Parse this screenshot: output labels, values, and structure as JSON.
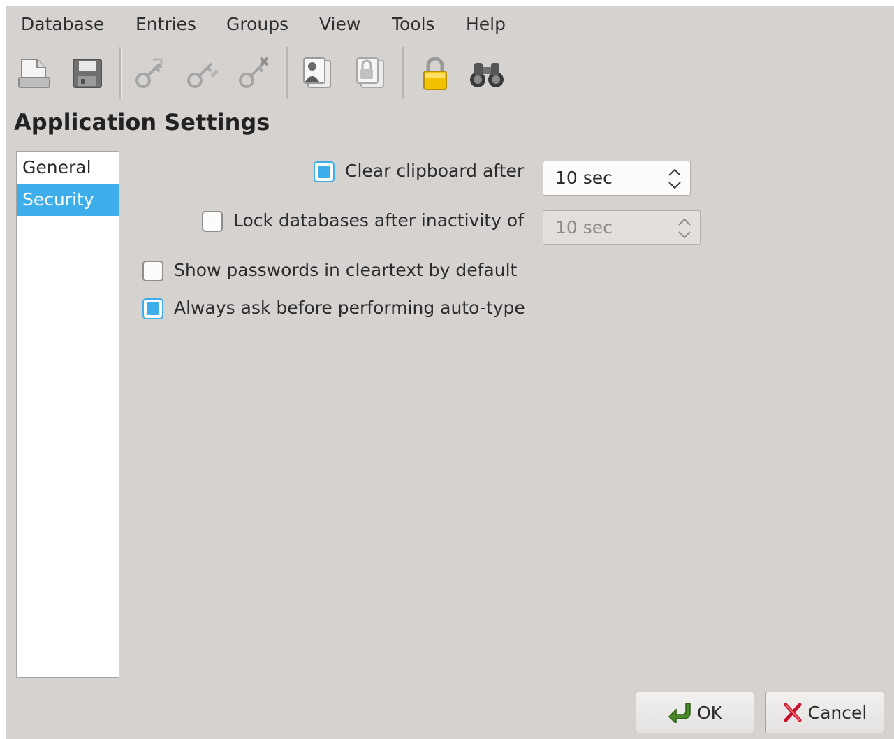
{
  "menubar": {
    "items": [
      "Database",
      "Entries",
      "Groups",
      "View",
      "Tools",
      "Help"
    ]
  },
  "toolbar": {
    "buttons": [
      {
        "icon": "new-database-icon"
      },
      {
        "icon": "save-database-icon"
      },
      {
        "icon": "add-entry-icon"
      },
      {
        "icon": "edit-entry-icon"
      },
      {
        "icon": "delete-entry-icon"
      },
      {
        "icon": "copy-username-icon"
      },
      {
        "icon": "copy-password-icon"
      },
      {
        "icon": "lock-database-icon"
      },
      {
        "icon": "search-binoculars-icon"
      }
    ]
  },
  "page": {
    "title": "Application Settings"
  },
  "categories": [
    {
      "label": "General",
      "selected": false
    },
    {
      "label": "Security",
      "selected": true
    }
  ],
  "security": {
    "clear_clipboard": {
      "label": "Clear clipboard after",
      "checked": true,
      "value": "10 sec",
      "enabled": true
    },
    "lock_inactivity": {
      "label": "Lock databases after inactivity of",
      "checked": false,
      "value": "10 sec",
      "enabled": false
    },
    "show_passwords": {
      "label": "Show passwords in cleartext by default",
      "checked": false
    },
    "ask_autotype": {
      "label": "Always ask before performing auto-type",
      "checked": true
    }
  },
  "buttons": {
    "ok": "OK",
    "cancel": "Cancel"
  },
  "colors": {
    "accent": "#3daee9",
    "window_bg": "#d6d2d0"
  }
}
